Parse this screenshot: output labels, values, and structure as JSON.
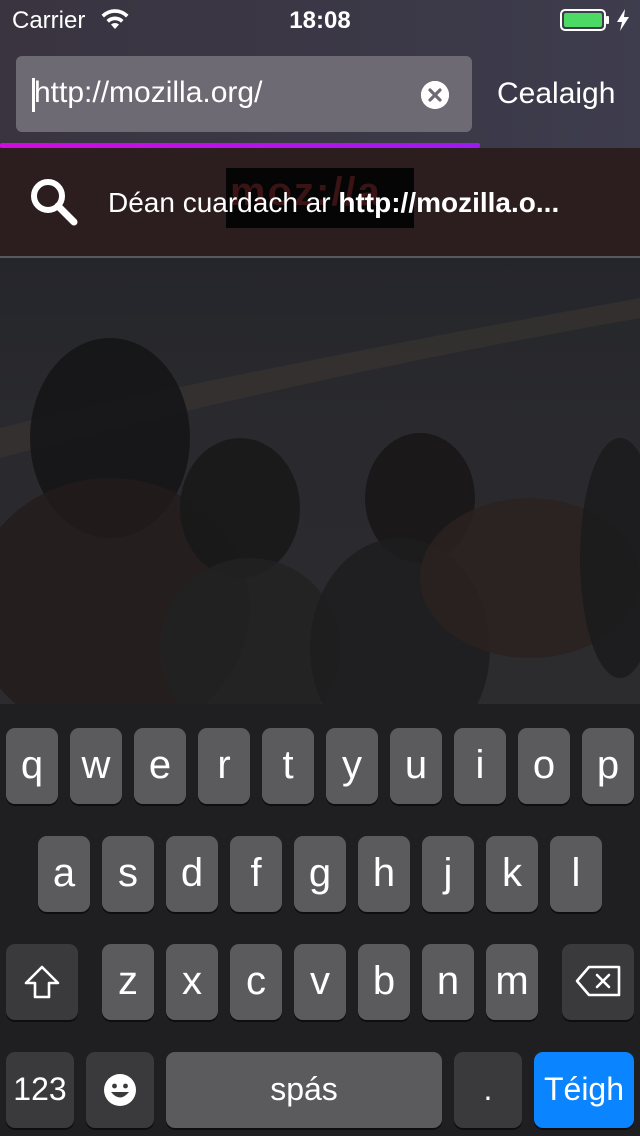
{
  "status_bar": {
    "carrier": "Carrier",
    "time": "18:08",
    "icons": [
      "wifi-icon",
      "battery-icon",
      "charging-icon"
    ]
  },
  "url_bar": {
    "value": "http://mozilla.org/",
    "clear_icon": "clear-circle-icon",
    "cancel_label": "Cealaigh",
    "progress": 0.75
  },
  "suggestion": {
    "prefix": "Déan cuardach ar ",
    "query": "http://mozilla.o...",
    "icon": "search-icon",
    "thumb_text": "moz://a"
  },
  "keyboard": {
    "row1": [
      "q",
      "w",
      "e",
      "r",
      "t",
      "y",
      "u",
      "i",
      "o",
      "p"
    ],
    "row2": [
      "a",
      "s",
      "d",
      "f",
      "g",
      "h",
      "j",
      "k",
      "l"
    ],
    "row3": [
      "z",
      "x",
      "c",
      "v",
      "b",
      "n",
      "m"
    ],
    "numbers_label": "123",
    "space_label": "spás",
    "period_label": ".",
    "go_label": "Téigh",
    "shift_icon": "shift-icon",
    "backspace_icon": "backspace-icon",
    "emoji_icon": "emoji-icon"
  },
  "colors": {
    "progress": "#d20be0",
    "go_key": "#0a84ff",
    "battery": "#4cd964"
  }
}
